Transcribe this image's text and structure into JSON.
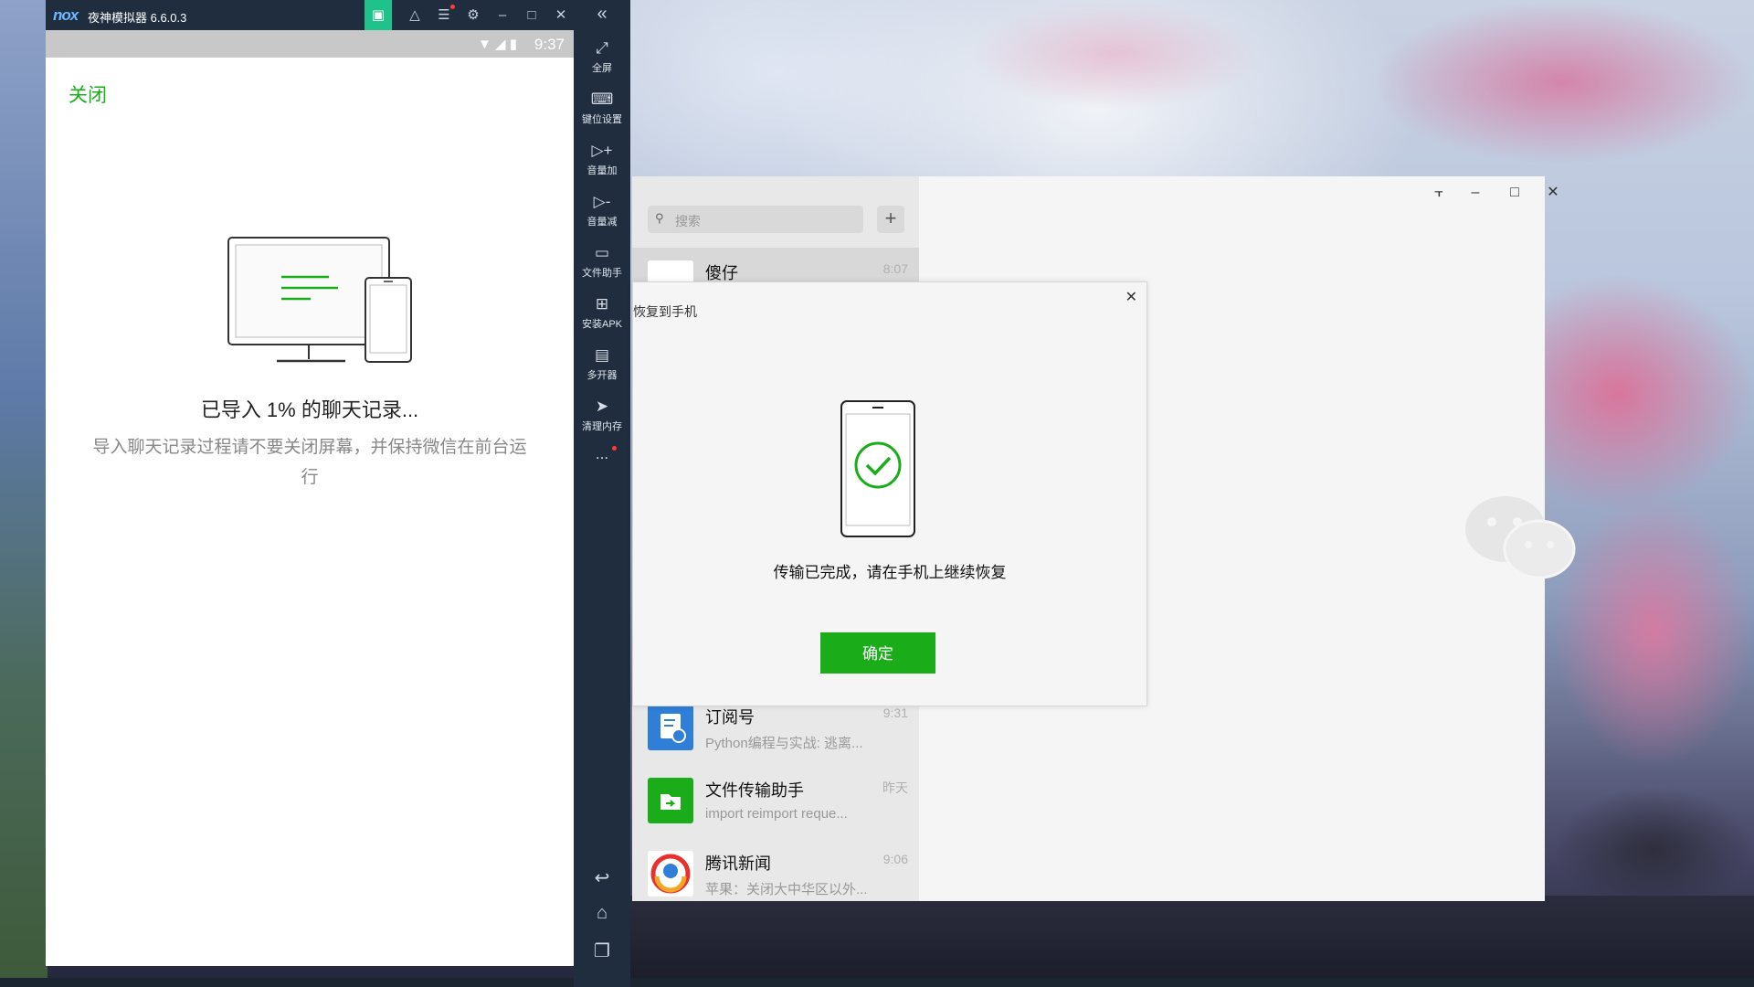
{
  "emulator": {
    "logo": "nox",
    "title": "夜神模拟器 6.6.0.3",
    "status_time": "9:37",
    "sidebar": [
      {
        "icon": "fullscreen-icon",
        "label": "全屏"
      },
      {
        "icon": "keyboard-icon",
        "label": "键位设置"
      },
      {
        "icon": "volume-up-icon",
        "label": "音量加"
      },
      {
        "icon": "volume-down-icon",
        "label": "音量减"
      },
      {
        "icon": "file-assistant-icon",
        "label": "文件助手"
      },
      {
        "icon": "apk-install-icon",
        "label": "安装APK"
      },
      {
        "icon": "multi-instance-icon",
        "label": "多开器"
      },
      {
        "icon": "rocket-icon",
        "label": "清理内存"
      }
    ],
    "more": "..."
  },
  "phone": {
    "close_label": "关闭",
    "import_title": "已导入 1% 的聊天记录...",
    "import_sub": "导入聊天记录过程请不要关闭屏幕，并保持微信在前台运行"
  },
  "wechat": {
    "search_placeholder": "搜索",
    "chats": [
      {
        "name": "傻仔",
        "time": "8:07",
        "message": ""
      },
      {
        "name": "订阅号",
        "time": "9:31",
        "message": "Python编程与实战: 逃离..."
      },
      {
        "name": "文件传输助手",
        "time": "昨天",
        "message": "import reimport reque..."
      },
      {
        "name": "腾讯新闻",
        "time": "9:06",
        "message": "苹果：关闭大中华区以外..."
      }
    ]
  },
  "dialog": {
    "title": "恢复到手机",
    "message": "传输已完成，请在手机上继续恢复",
    "ok_label": "确定"
  },
  "colors": {
    "wechat_green": "#1aad19",
    "nox_dark": "#1f2d3f",
    "nox_accent": "#1fc28a"
  }
}
